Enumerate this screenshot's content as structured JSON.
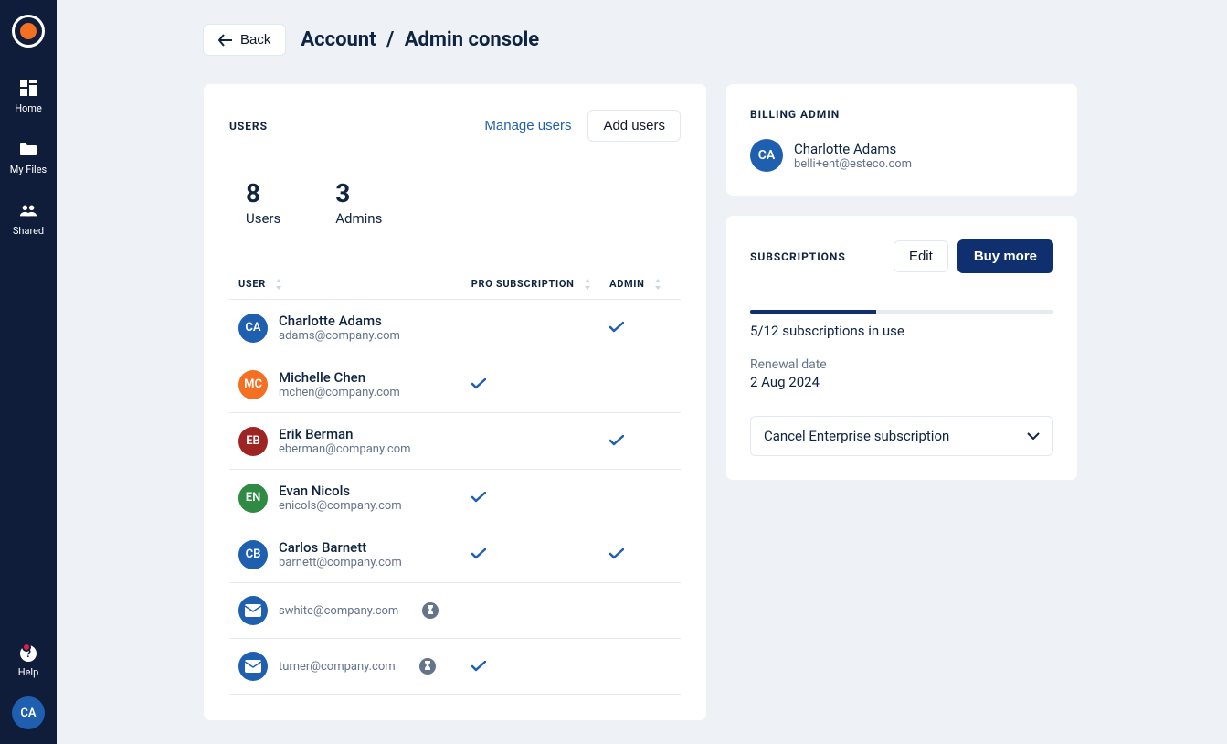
{
  "sidebar": {
    "items": [
      {
        "label": "Home"
      },
      {
        "label": "My Files"
      },
      {
        "label": "Shared"
      }
    ],
    "help_label": "Help",
    "avatar_initials": "CA"
  },
  "header": {
    "back_label": "Back",
    "breadcrumb_parent": "Account",
    "breadcrumb_current": "Admin console"
  },
  "users_panel": {
    "title": "USERS",
    "manage_label": "Manage users",
    "add_label": "Add users",
    "stats": {
      "users_count": "8",
      "users_label": "Users",
      "admins_count": "3",
      "admins_label": "Admins"
    },
    "columns": {
      "user": "USER",
      "pro": "PRO SUBSCRIPTION",
      "admin": "ADMIN"
    },
    "rows": [
      {
        "initials": "CA",
        "color": "#1f5fb0",
        "name": "Charlotte Adams",
        "email": "adams@company.com",
        "pro": false,
        "admin": true,
        "pending": false
      },
      {
        "initials": "MC",
        "color": "#f36f21",
        "name": "Michelle Chen",
        "email": "mchen@company.com",
        "pro": true,
        "admin": false,
        "pending": false
      },
      {
        "initials": "EB",
        "color": "#9e2424",
        "name": "Erik Berman",
        "email": "eberman@company.com",
        "pro": false,
        "admin": true,
        "pending": false
      },
      {
        "initials": "EN",
        "color": "#2f8a44",
        "name": "Evan Nicols",
        "email": "enicols@company.com",
        "pro": true,
        "admin": false,
        "pending": false
      },
      {
        "initials": "CB",
        "color": "#1f5fb0",
        "name": "Carlos Barnett",
        "email": "barnett@company.com",
        "pro": true,
        "admin": true,
        "pending": false
      },
      {
        "initials": "",
        "color": "#1f5fb0",
        "name": "",
        "email": "swhite@company.com",
        "pro": false,
        "admin": false,
        "pending": true
      },
      {
        "initials": "",
        "color": "#1f5fb0",
        "name": "",
        "email": "turner@company.com",
        "pro": true,
        "admin": false,
        "pending": true
      }
    ]
  },
  "billing_panel": {
    "title": "BILLING ADMIN",
    "admin_initials": "CA",
    "admin_name": "Charlotte Adams",
    "admin_email": "belli+ent@esteco.com"
  },
  "subs_panel": {
    "title": "SUBSCRIPTIONS",
    "edit_label": "Edit",
    "buy_label": "Buy more",
    "in_use_text": "5/12 subscriptions in use",
    "progress_percent": 41.6,
    "renewal_label": "Renewal date",
    "renewal_date": "2 Aug 2024",
    "cancel_label": "Cancel Enterprise subscription"
  }
}
